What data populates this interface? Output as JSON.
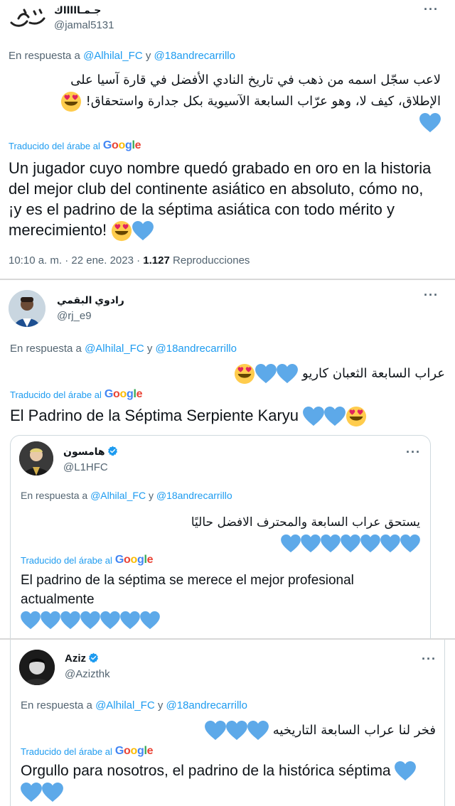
{
  "tweet1": {
    "name": "جـمـاااااك",
    "handle": "@jamal5131",
    "reply_prefix": "En respuesta a",
    "mention1": "@Alhilal_FC",
    "reply_and": "y",
    "mention2": "@18andrecarrillo",
    "arabic_line1": "لاعب سجّل اسمه من ذهب في تاريخ النادي الأفضل في قارة آسيا على",
    "arabic_line2": "الإطلاق، كيف لا، وهو عرّاب السابعة الآسيوية بكل جدارة واستحقاق!",
    "translated_label": "Traducido del árabe al",
    "google": "Google",
    "spanish": "Un jugador cuyo nombre quedó grabado en oro en la historia del mejor club del continente asiático en absoluto, cómo no, ¡y es el padrino de la séptima asiática con todo mérito y merecimiento!",
    "time": "10:10 a. m. · 22 ene. 2023 ·",
    "views": "1.127",
    "views_label": "Reproducciones"
  },
  "tweet2": {
    "name": "رادوي البقمي",
    "handle": "@rj_e9",
    "reply_prefix": "En respuesta a",
    "mention1": "@Alhilal_FC",
    "reply_and": "y",
    "mention2": "@18andrecarrillo",
    "arabic": "عراب السابعة الثعبان كاريو",
    "translated_label": "Traducido del árabe al",
    "google": "Google",
    "spanish": "El Padrino de la Séptima Serpiente Karyu"
  },
  "tweet3": {
    "name": "هامسون",
    "handle": "@L1HFC",
    "reply_prefix": "En respuesta a",
    "mention1": "@Alhilal_FC",
    "reply_and": "y",
    "mention2": "@18andrecarrillo",
    "arabic": "يستحق عراب السابعة والمحترف الافضل حاليًا",
    "translated_label": "Traducido del árabe al",
    "google": "Google",
    "spanish": "El padrino de la séptima se merece el mejor profesional actualmente"
  },
  "tweet4": {
    "name": "Aziz",
    "handle": "@Azizthk",
    "reply_prefix": "En respuesta a",
    "mention1": "@Alhilal_FC",
    "reply_and": "y",
    "mention2": "@18andrecarrillo",
    "arabic": "فخر لنا عراب السابعة التاريخيه",
    "translated_label": "Traducido del árabe al",
    "google": "Google",
    "spanish": "Orgullo para nosotros, el padrino de la histórica séptima"
  },
  "more_label": "···",
  "colors": {
    "heart": "#5da9e9",
    "link": "#1d9bf0",
    "secondary": "#536471",
    "verified": "#1d9bf0"
  }
}
